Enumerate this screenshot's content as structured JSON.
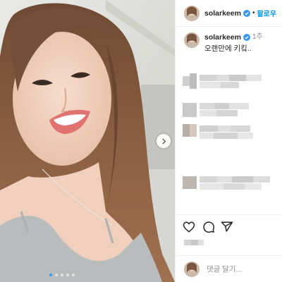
{
  "post": {
    "username": "solarkeem",
    "follow_label": "팔로우",
    "separator": "•",
    "verified": true,
    "caption": {
      "username": "solarkeem",
      "time": "1주",
      "text": "오랜만에 키킼.."
    },
    "comments_visible_but_pixelated": 4,
    "likes_text_pixelated": true,
    "comment_placeholder": "댓글 달기...",
    "carousel": {
      "count": 5,
      "active_index": 0
    }
  },
  "colors": {
    "accent": "#0095f6",
    "verified": "#3897f0",
    "text": "#262626",
    "muted": "#8e8e8e",
    "divider": "#efefef"
  },
  "icons": {
    "actions": [
      "heart-icon",
      "comment-icon",
      "share-icon"
    ],
    "carousel": "chevron-right-icon",
    "badge": "verified-badge-icon"
  }
}
